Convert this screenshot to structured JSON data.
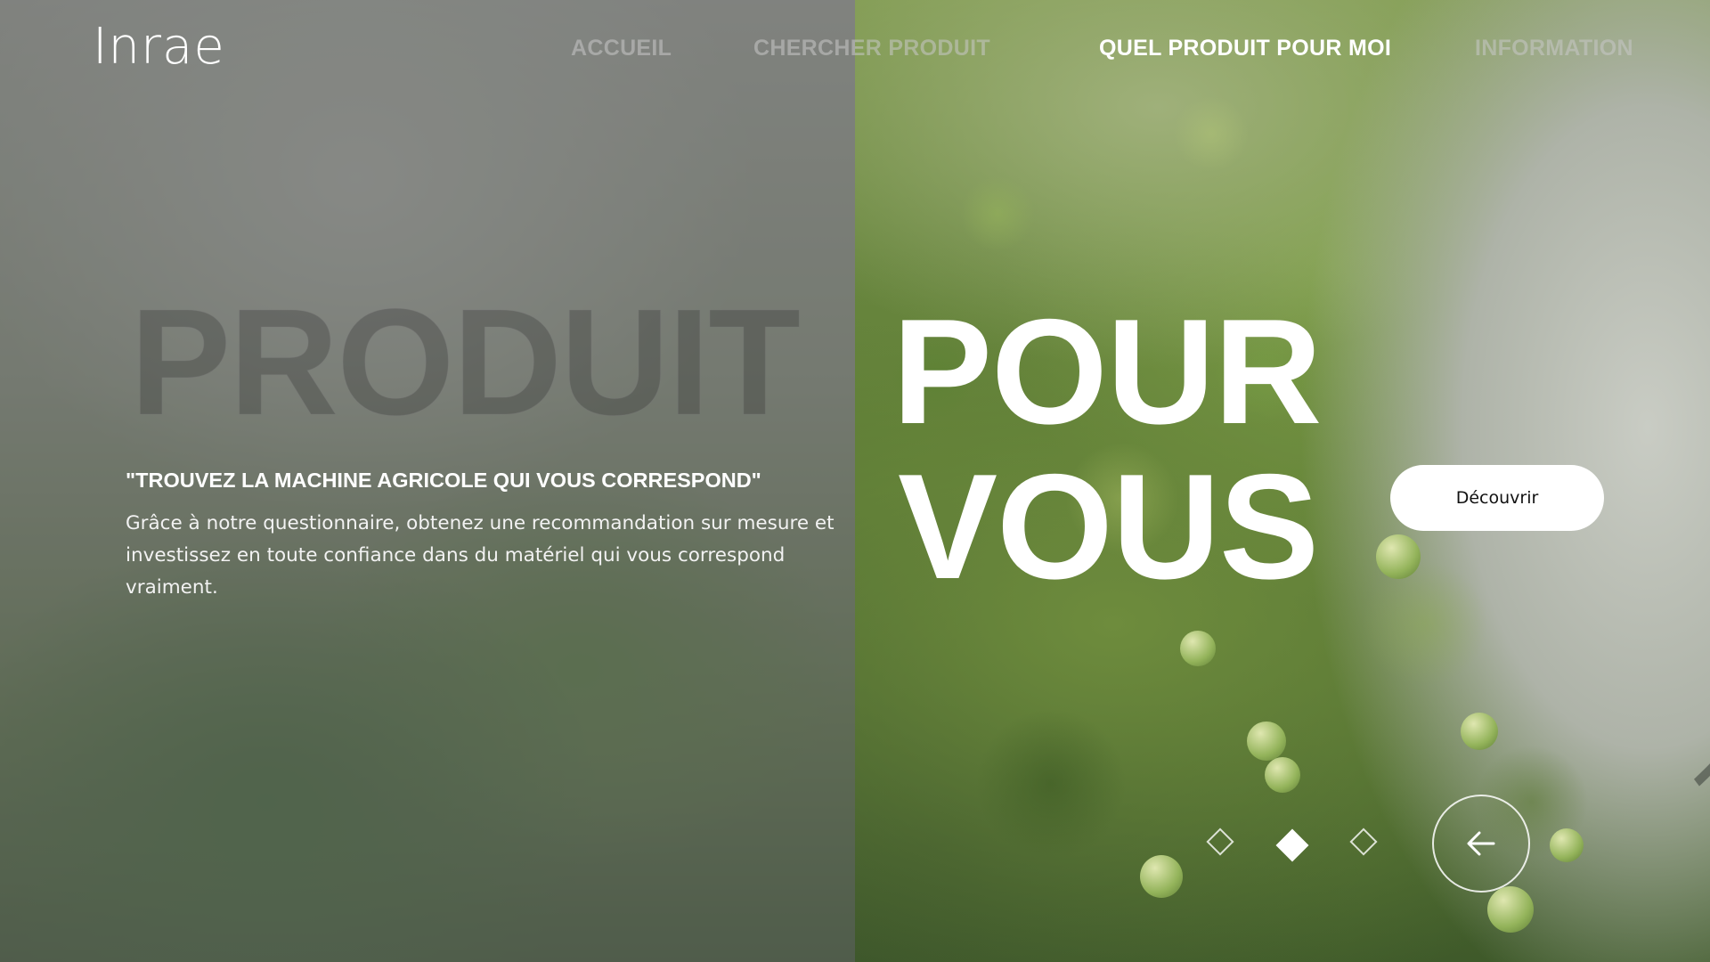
{
  "brand": {
    "logo_text": "Inrae"
  },
  "nav": {
    "items": [
      {
        "label": "ACCUEIL"
      },
      {
        "label": "CHERCHER PRODUIT"
      },
      {
        "label": "QUEL PRODUIT POUR MOI",
        "active": true
      },
      {
        "label": "INFORMATION"
      }
    ]
  },
  "hero": {
    "word_1": "PRODUIT",
    "word_2": "POUR",
    "word_3": "VOUS",
    "quote": "\"TROUVEZ LA MACHINE AGRICOLE QUI VOUS CORRESPOND\"",
    "description": "Grâce à notre questionnaire, obtenez une recommandation sur mesure et investissez en toute confiance dans du matériel qui vous correspond vraiment.",
    "cta_label": "Découvrir"
  },
  "slider": {
    "slide_count": 3,
    "active_index": 1,
    "control_icon": "arrow-left-icon"
  },
  "colors": {
    "text": "#ffffff",
    "cta_background": "#ffffff",
    "cta_text": "#111111",
    "inactive_nav": "#c8c8c8"
  }
}
